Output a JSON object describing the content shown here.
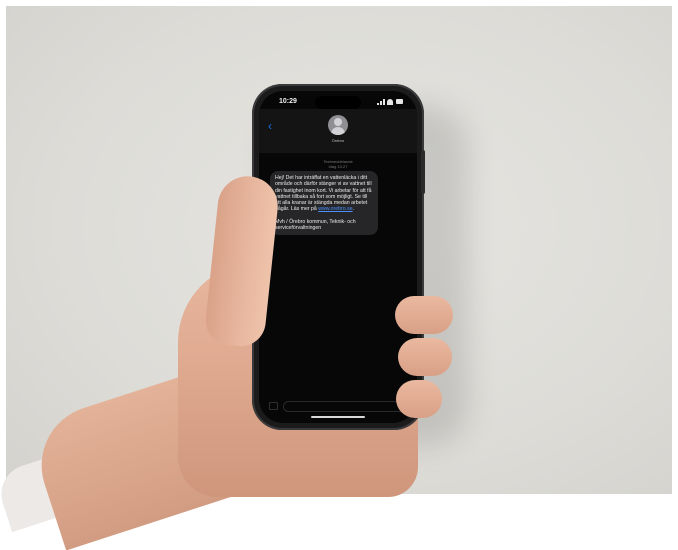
{
  "status_bar": {
    "time": "10:29"
  },
  "conversation": {
    "contact_name": "Örebro",
    "date_label_line1": "Textmeddelande",
    "date_label_line2": "Idag 10:27"
  },
  "message": {
    "paragraph1": "Hej! Det har inträffat en vattenläcka i ditt område och därför stänger vi av vattnet till din fastighet inom kort. Vi arbetar för att få vattnet tillbaka så fort som möjligt. Se till att alla kranar är stängda medan arbetet pågår. Läs mer på ",
    "link_text": "www.orebro.se",
    "paragraph1_end": ".",
    "paragraph2": "Mvh / Örebro kommun, Teknik- och serviceförvaltningen"
  },
  "icons": {
    "back": "chevron-left-icon",
    "avatar": "person-avatar-icon",
    "camera": "camera-icon"
  },
  "colors": {
    "link": "#4a90ff",
    "back_button": "#1a73e8",
    "bubble": "#262628",
    "screen": "#070707"
  }
}
